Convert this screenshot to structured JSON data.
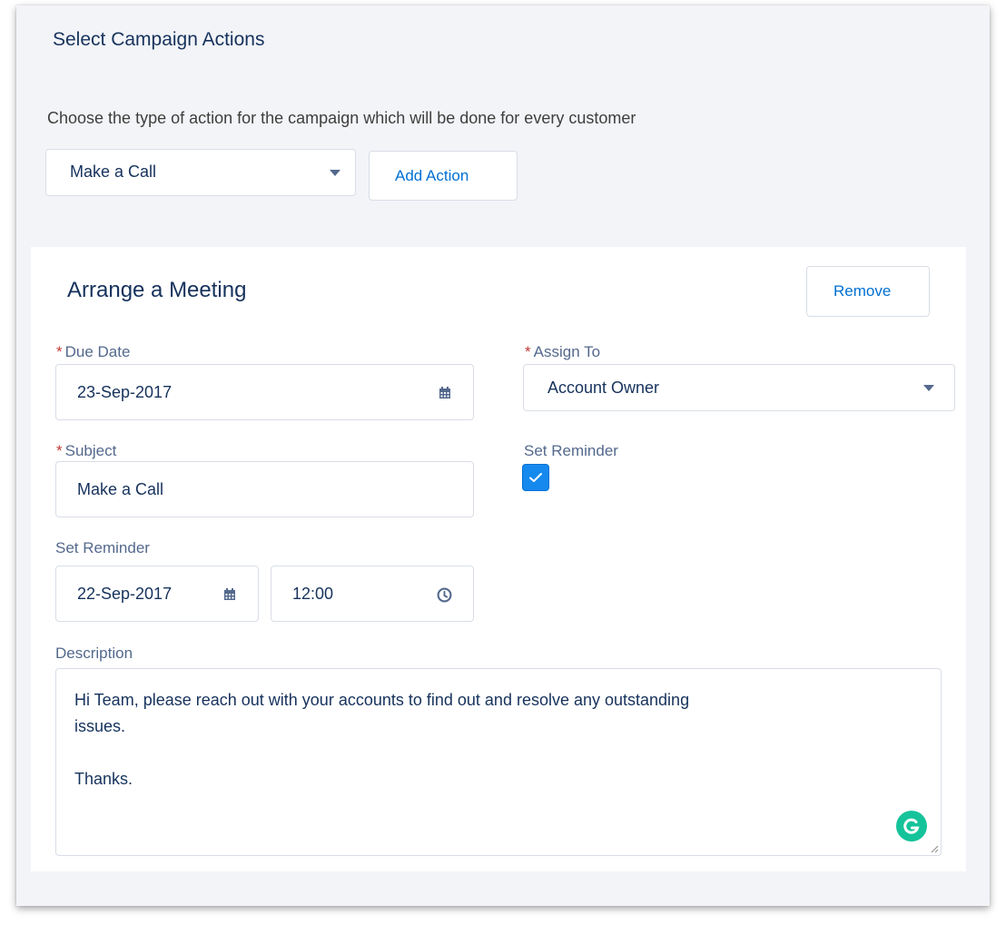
{
  "section": {
    "title": "Select Campaign Actions",
    "intro": "Choose the type of action for the campaign which will be done for every customer",
    "action_select": {
      "value": "Make a Call"
    },
    "add_action_label": "Add Action"
  },
  "card": {
    "title": "Arrange a Meeting",
    "remove_label": "Remove",
    "due_date": {
      "label": "Due Date",
      "value": "23-Sep-2017"
    },
    "assign_to": {
      "label": "Assign To",
      "value": "Account Owner"
    },
    "subject": {
      "label": "Subject",
      "value": "Make a Call"
    },
    "set_reminder_checkbox": {
      "label": "Set Reminder",
      "checked": true
    },
    "reminder": {
      "label": "Set Reminder",
      "date": "22-Sep-2017",
      "time": "12:00"
    },
    "description": {
      "label": "Description",
      "value": "Hi Team, please reach out with your accounts to find out and resolve any outstanding\nissues.\n\nThanks."
    },
    "required_marker": "*"
  },
  "colors": {
    "accent": "#0070d2",
    "checkbox": "#1589ee",
    "required": "#c23934",
    "grammarly": "#15c39a"
  }
}
